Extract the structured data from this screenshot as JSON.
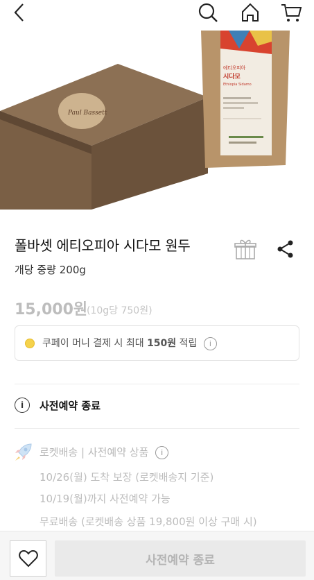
{
  "product": {
    "title": "폴바셋 에티오피아 시다모 원두",
    "option": "개당 중량 200g",
    "price": "15,000원",
    "unit_price": "(10g당 750원)"
  },
  "coupay": {
    "prefix": "쿠페이 머니 결제 시 최대 ",
    "amount": "150원",
    "suffix": " 적립",
    "info": "i"
  },
  "reservation": {
    "status": "사전예약 종료",
    "info": "i"
  },
  "shipping": {
    "header": "로켓배송 | 사전예약 상품",
    "info": "i",
    "lines": [
      "10/26(월) 도착 보장 (로켓배송지 기준)",
      "10/19(월)까지 사전예약 가능",
      "무료배송 (로켓배송 상품 19,800원 이상 구매 시)"
    ]
  },
  "product_image": {
    "bag_label_line1": "에티오피아",
    "bag_label_line2": "시다모",
    "bag_label_line3": "Ethiopia Sidamo"
  },
  "bottom": {
    "cta_label": "사전예약 종료"
  },
  "colors": {
    "price_disabled": "#bdbdbd",
    "coin": "#f5d24c",
    "kraft": "#8f7150"
  },
  "icons": [
    "back-icon",
    "search-icon",
    "home-icon",
    "cart-icon",
    "gift-icon",
    "share-icon",
    "coin-icon",
    "info-icon",
    "rocket-icon",
    "heart-icon"
  ]
}
